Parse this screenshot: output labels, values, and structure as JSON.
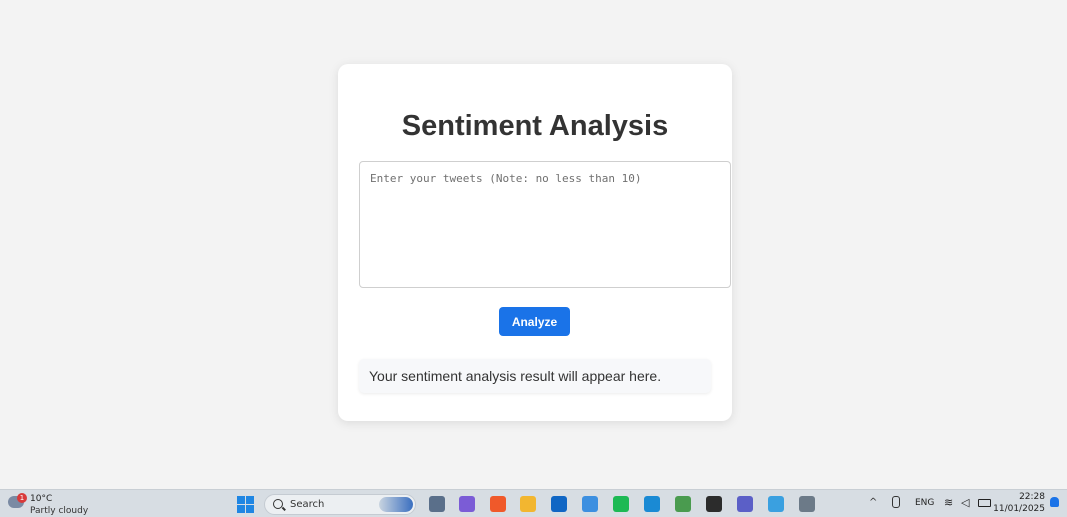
{
  "app": {
    "title": "Sentiment Analysis",
    "input_placeholder": "Enter your tweets (Note: no less than 10)",
    "input_value": "",
    "analyze_label": "Analyze",
    "result_text": "Your sentiment analysis result will appear here.",
    "accent_color": "#1a73e8"
  },
  "taskbar": {
    "weather": {
      "badge": "1",
      "temperature": "10°C",
      "description": "Partly cloudy",
      "icon": "weather-partly-cloudy-icon"
    },
    "search_label": "Search",
    "apps": [
      {
        "name": "file-viewer-icon",
        "color": "#5a6f8a"
      },
      {
        "name": "copilot-icon",
        "color": "#7b5cd6"
      },
      {
        "name": "brave-icon",
        "color": "#f0592a"
      },
      {
        "name": "file-explorer-icon",
        "color": "#f2b630"
      },
      {
        "name": "outlook-icon",
        "color": "#1066c4"
      },
      {
        "name": "store-icon",
        "color": "#3c8fe0"
      },
      {
        "name": "spotify-icon",
        "color": "#1db954"
      },
      {
        "name": "edge-icon",
        "color": "#1a8ad4"
      },
      {
        "name": "chrome-icon",
        "color": "#4a9b4f"
      },
      {
        "name": "terminal-icon",
        "color": "#2c2c2c"
      },
      {
        "name": "teams-icon",
        "color": "#5b5fc7"
      },
      {
        "name": "notepad-icon",
        "color": "#3aa0e0"
      },
      {
        "name": "snipping-tool-icon",
        "color": "#6c7a88"
      }
    ],
    "tray": {
      "language": "ENG",
      "time": "22:28",
      "date": "11/01/2025"
    }
  }
}
